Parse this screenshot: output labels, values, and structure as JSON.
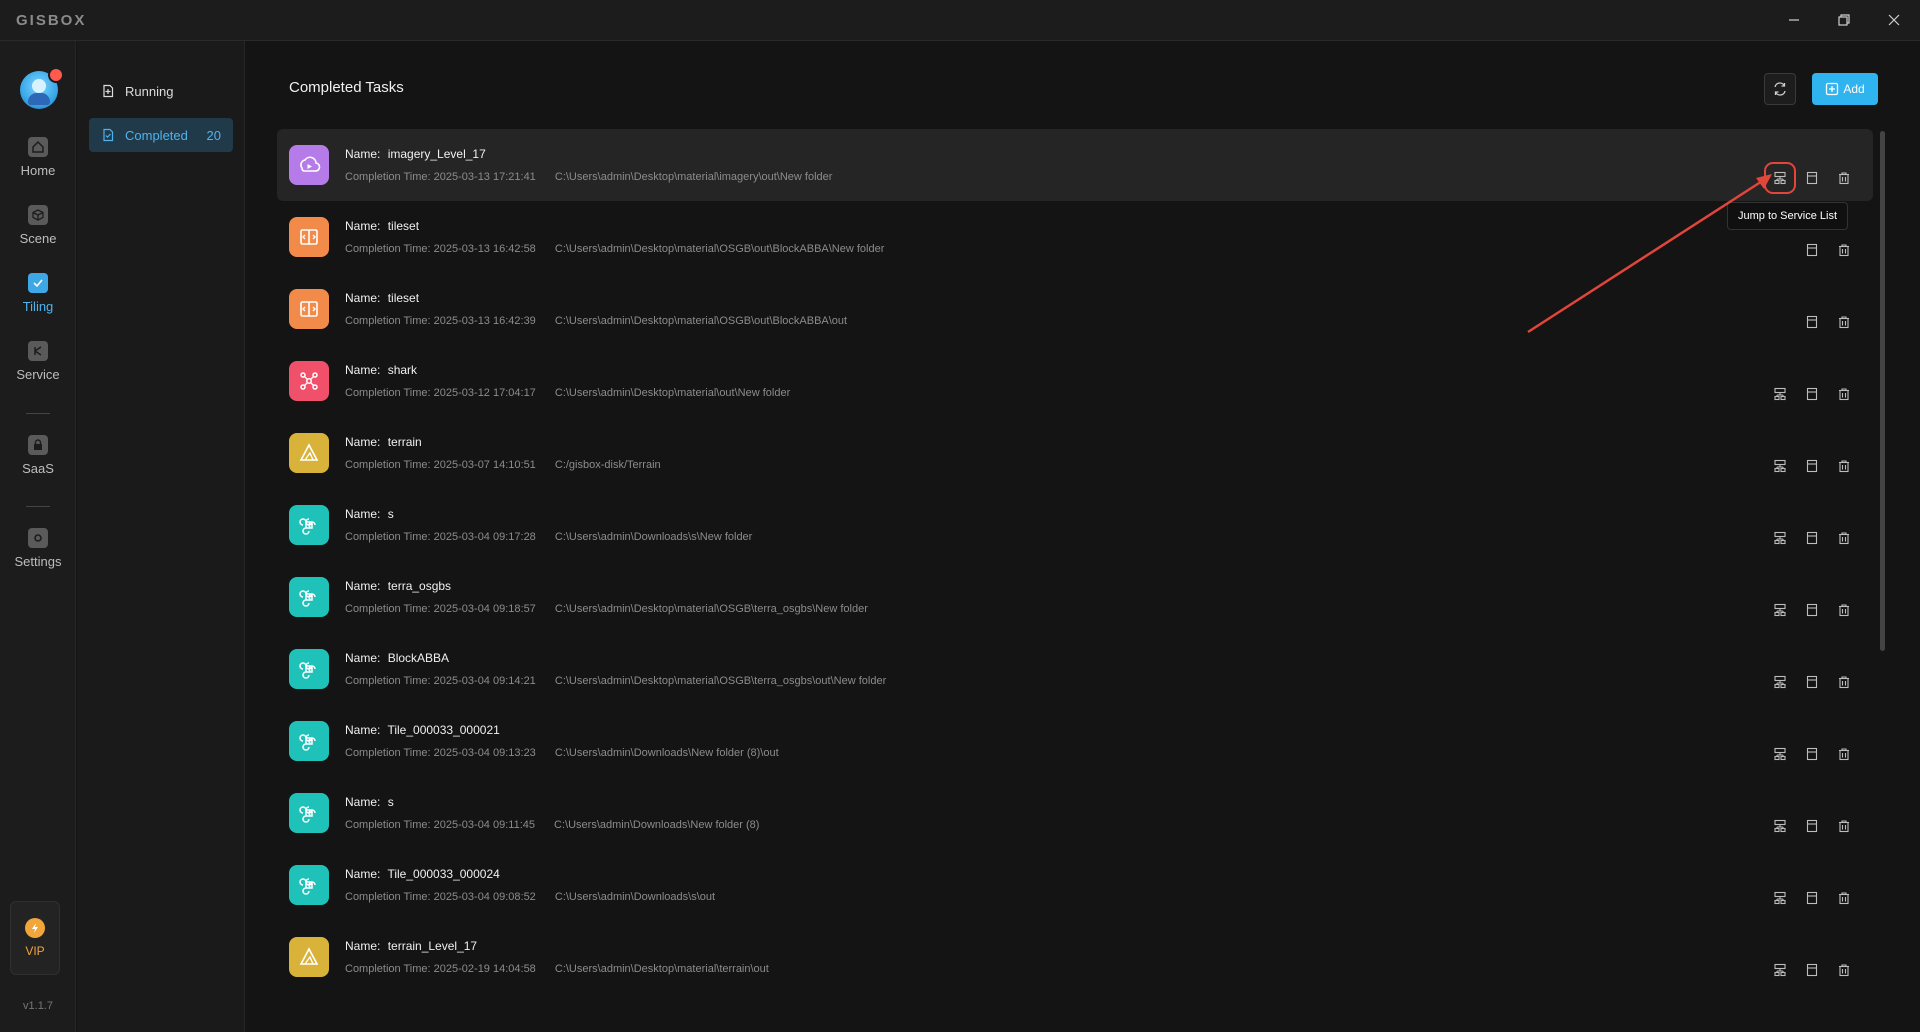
{
  "app": {
    "logo_text": "GISBOX",
    "version": "v1.1.7"
  },
  "window_controls": [
    "minimize-icon",
    "restore-icon",
    "close-icon"
  ],
  "nav": {
    "items": [
      {
        "label": "Home",
        "icon": "home-icon",
        "active": false
      },
      {
        "label": "Scene",
        "icon": "cube-icon",
        "active": false
      },
      {
        "label": "Tiling",
        "icon": "tiling-icon",
        "active": true
      },
      {
        "label": "Service",
        "icon": "service-icon",
        "active": false
      },
      {
        "label": "SaaS",
        "icon": "lock-icon",
        "active": false
      },
      {
        "label": "Settings",
        "icon": "gear-icon",
        "active": false
      }
    ],
    "vip_label": "VIP"
  },
  "subnav": {
    "running_label": "Running",
    "completed_label": "Completed",
    "completed_count": "20"
  },
  "main": {
    "title": "Completed Tasks",
    "add_label": "Add",
    "name_label": "Name:",
    "completion_label": "Completion Time:",
    "tooltip": "Jump to Service List"
  },
  "colors": {
    "accent": "#2fb4f0",
    "imagery": "#b57be8",
    "tileset": "#f28b4a",
    "shark": "#f0506a",
    "terrain": "#d9b23a",
    "osgb": "#1fc2b8",
    "highlight_box": "#e2453a"
  },
  "tasks": [
    {
      "name": "imagery_Level_17",
      "time": "2025-03-13 17:21:41",
      "path": "C:\\Users\\admin\\Desktop\\material\\imagery\\out\\New folder",
      "type": "imagery",
      "actions": 3
    },
    {
      "name": "tileset",
      "time": "2025-03-13 16:42:58",
      "path": "C:\\Users\\admin\\Desktop\\material\\OSGB\\out\\BlockABBA\\New folder",
      "type": "tileset",
      "actions": 2
    },
    {
      "name": "tileset",
      "time": "2025-03-13 16:42:39",
      "path": "C:\\Users\\admin\\Desktop\\material\\OSGB\\out\\BlockABBA\\out",
      "type": "tileset",
      "actions": 2
    },
    {
      "name": "shark",
      "time": "2025-03-12 17:04:17",
      "path": "C:\\Users\\admin\\Desktop\\material\\out\\New folder",
      "type": "shark",
      "actions": 3
    },
    {
      "name": "terrain",
      "time": "2025-03-07 14:10:51",
      "path": "C:/gisbox-disk/Terrain",
      "type": "terrain",
      "actions": 3
    },
    {
      "name": "s",
      "time": "2025-03-04 09:17:28",
      "path": "C:\\Users\\admin\\Downloads\\s\\New folder",
      "type": "osgb",
      "actions": 3
    },
    {
      "name": "terra_osgbs",
      "time": "2025-03-04 09:18:57",
      "path": "C:\\Users\\admin\\Desktop\\material\\OSGB\\terra_osgbs\\New folder",
      "type": "osgb",
      "actions": 3
    },
    {
      "name": "BlockABBA",
      "time": "2025-03-04 09:14:21",
      "path": "C:\\Users\\admin\\Desktop\\material\\OSGB\\terra_osgbs\\out\\New folder",
      "type": "osgb",
      "actions": 3
    },
    {
      "name": "Tile_000033_000021",
      "time": "2025-03-04 09:13:23",
      "path": "C:\\Users\\admin\\Downloads\\New folder (8)\\out",
      "type": "osgb",
      "actions": 3
    },
    {
      "name": "s",
      "time": "2025-03-04 09:11:45",
      "path": "C:\\Users\\admin\\Downloads\\New folder (8)",
      "type": "osgb",
      "actions": 3
    },
    {
      "name": "Tile_000033_000024",
      "time": "2025-03-04 09:08:52",
      "path": "C:\\Users\\admin\\Downloads\\s\\out",
      "type": "osgb",
      "actions": 3
    },
    {
      "name": "terrain_Level_17",
      "time": "2025-02-19 14:04:58",
      "path": "C:\\Users\\admin\\Desktop\\material\\terrain\\out",
      "type": "terrain",
      "actions": 3
    }
  ]
}
